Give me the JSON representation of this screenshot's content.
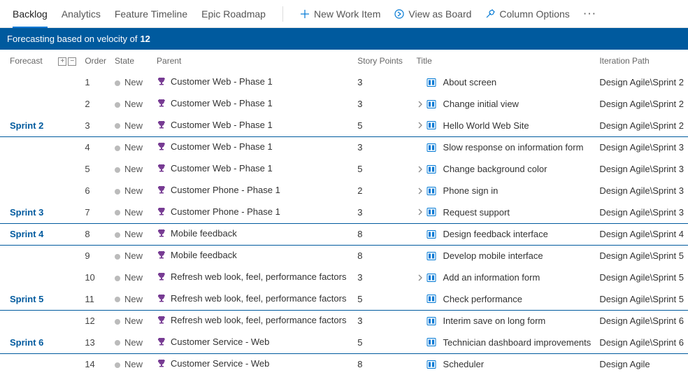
{
  "toolbar": {
    "tabs": [
      "Backlog",
      "Analytics",
      "Feature Timeline",
      "Epic Roadmap"
    ],
    "activeTab": 0,
    "actions": {
      "new_item": "New Work Item",
      "view_board": "View as Board",
      "column_options": "Column Options"
    }
  },
  "banner": {
    "text": "Forecasting based on velocity of",
    "value": "12"
  },
  "columns": {
    "forecast": "Forecast",
    "order": "Order",
    "state": "State",
    "parent": "Parent",
    "story_points": "Story Points",
    "title": "Title",
    "iteration": "Iteration Path"
  },
  "rows": [
    {
      "forecast": "",
      "order": "1",
      "state": "New",
      "parent": "Customer Web - Phase 1",
      "sp": "3",
      "expandable": false,
      "title": "About screen",
      "iteration": "Design Agile\\Sprint 2",
      "sprintEnd": false
    },
    {
      "forecast": "",
      "order": "2",
      "state": "New",
      "parent": "Customer Web - Phase 1",
      "sp": "3",
      "expandable": true,
      "title": "Change initial view",
      "iteration": "Design Agile\\Sprint 2",
      "sprintEnd": false
    },
    {
      "forecast": "Sprint 2",
      "order": "3",
      "state": "New",
      "parent": "Customer Web - Phase 1",
      "sp": "5",
      "expandable": true,
      "title": "Hello World Web Site",
      "iteration": "Design Agile\\Sprint 2",
      "sprintEnd": true
    },
    {
      "forecast": "",
      "order": "4",
      "state": "New",
      "parent": "Customer Web - Phase 1",
      "sp": "3",
      "expandable": false,
      "title": "Slow response on information form",
      "iteration": "Design Agile\\Sprint 3",
      "sprintEnd": false
    },
    {
      "forecast": "",
      "order": "5",
      "state": "New",
      "parent": "Customer Web - Phase 1",
      "sp": "5",
      "expandable": true,
      "title": "Change background color",
      "iteration": "Design Agile\\Sprint 3",
      "sprintEnd": false
    },
    {
      "forecast": "",
      "order": "6",
      "state": "New",
      "parent": "Customer Phone - Phase 1",
      "sp": "2",
      "expandable": true,
      "title": "Phone sign in",
      "iteration": "Design Agile\\Sprint 3",
      "sprintEnd": false
    },
    {
      "forecast": "Sprint 3",
      "order": "7",
      "state": "New",
      "parent": "Customer Phone - Phase 1",
      "sp": "3",
      "expandable": true,
      "title": "Request support",
      "iteration": "Design Agile\\Sprint 3",
      "sprintEnd": true
    },
    {
      "forecast": "Sprint 4",
      "order": "8",
      "state": "New",
      "parent": "Mobile feedback",
      "sp": "8",
      "expandable": false,
      "title": "Design feedback interface",
      "iteration": "Design Agile\\Sprint 4",
      "sprintEnd": true
    },
    {
      "forecast": "",
      "order": "9",
      "state": "New",
      "parent": "Mobile feedback",
      "sp": "8",
      "expandable": false,
      "title": "Develop mobile interface",
      "iteration": "Design Agile\\Sprint 5",
      "sprintEnd": false
    },
    {
      "forecast": "",
      "order": "10",
      "state": "New",
      "parent": "Refresh web look, feel, performance factors",
      "sp": "3",
      "expandable": true,
      "title": "Add an information form",
      "iteration": "Design Agile\\Sprint 5",
      "sprintEnd": false
    },
    {
      "forecast": "Sprint 5",
      "order": "11",
      "state": "New",
      "parent": "Refresh web look, feel, performance factors",
      "sp": "5",
      "expandable": false,
      "title": "Check performance",
      "iteration": "Design Agile\\Sprint 5",
      "sprintEnd": true
    },
    {
      "forecast": "",
      "order": "12",
      "state": "New",
      "parent": "Refresh web look, feel, performance factors",
      "sp": "3",
      "expandable": false,
      "title": "Interim save on long form",
      "iteration": "Design Agile\\Sprint 6",
      "sprintEnd": false
    },
    {
      "forecast": "Sprint 6",
      "order": "13",
      "state": "New",
      "parent": "Customer Service - Web",
      "sp": "5",
      "expandable": false,
      "title": "Technician dashboard improvements",
      "iteration": "Design Agile\\Sprint 6",
      "sprintEnd": true
    },
    {
      "forecast": "",
      "order": "14",
      "state": "New",
      "parent": "Customer Service - Web",
      "sp": "8",
      "expandable": false,
      "title": "Scheduler",
      "iteration": "Design Agile",
      "sprintEnd": false
    }
  ]
}
